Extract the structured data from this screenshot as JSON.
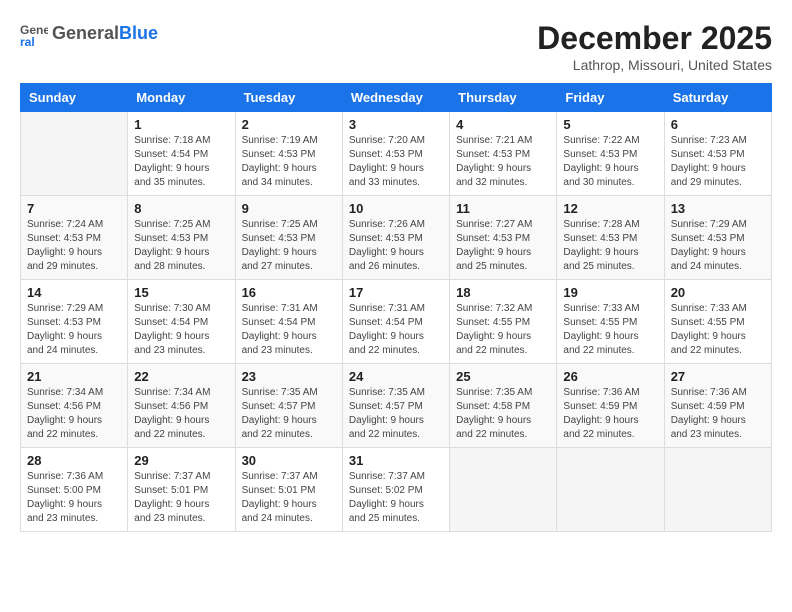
{
  "header": {
    "logo_general": "General",
    "logo_blue": "Blue",
    "title": "December 2025",
    "subtitle": "Lathrop, Missouri, United States"
  },
  "weekdays": [
    "Sunday",
    "Monday",
    "Tuesday",
    "Wednesday",
    "Thursday",
    "Friday",
    "Saturday"
  ],
  "weeks": [
    [
      {
        "day": "",
        "sunrise": "",
        "sunset": "",
        "daylight": ""
      },
      {
        "day": "1",
        "sunrise": "Sunrise: 7:18 AM",
        "sunset": "Sunset: 4:54 PM",
        "daylight": "Daylight: 9 hours and 35 minutes."
      },
      {
        "day": "2",
        "sunrise": "Sunrise: 7:19 AM",
        "sunset": "Sunset: 4:53 PM",
        "daylight": "Daylight: 9 hours and 34 minutes."
      },
      {
        "day": "3",
        "sunrise": "Sunrise: 7:20 AM",
        "sunset": "Sunset: 4:53 PM",
        "daylight": "Daylight: 9 hours and 33 minutes."
      },
      {
        "day": "4",
        "sunrise": "Sunrise: 7:21 AM",
        "sunset": "Sunset: 4:53 PM",
        "daylight": "Daylight: 9 hours and 32 minutes."
      },
      {
        "day": "5",
        "sunrise": "Sunrise: 7:22 AM",
        "sunset": "Sunset: 4:53 PM",
        "daylight": "Daylight: 9 hours and 30 minutes."
      },
      {
        "day": "6",
        "sunrise": "Sunrise: 7:23 AM",
        "sunset": "Sunset: 4:53 PM",
        "daylight": "Daylight: 9 hours and 29 minutes."
      }
    ],
    [
      {
        "day": "7",
        "sunrise": "Sunrise: 7:24 AM",
        "sunset": "Sunset: 4:53 PM",
        "daylight": "Daylight: 9 hours and 29 minutes."
      },
      {
        "day": "8",
        "sunrise": "Sunrise: 7:25 AM",
        "sunset": "Sunset: 4:53 PM",
        "daylight": "Daylight: 9 hours and 28 minutes."
      },
      {
        "day": "9",
        "sunrise": "Sunrise: 7:25 AM",
        "sunset": "Sunset: 4:53 PM",
        "daylight": "Daylight: 9 hours and 27 minutes."
      },
      {
        "day": "10",
        "sunrise": "Sunrise: 7:26 AM",
        "sunset": "Sunset: 4:53 PM",
        "daylight": "Daylight: 9 hours and 26 minutes."
      },
      {
        "day": "11",
        "sunrise": "Sunrise: 7:27 AM",
        "sunset": "Sunset: 4:53 PM",
        "daylight": "Daylight: 9 hours and 25 minutes."
      },
      {
        "day": "12",
        "sunrise": "Sunrise: 7:28 AM",
        "sunset": "Sunset: 4:53 PM",
        "daylight": "Daylight: 9 hours and 25 minutes."
      },
      {
        "day": "13",
        "sunrise": "Sunrise: 7:29 AM",
        "sunset": "Sunset: 4:53 PM",
        "daylight": "Daylight: 9 hours and 24 minutes."
      }
    ],
    [
      {
        "day": "14",
        "sunrise": "Sunrise: 7:29 AM",
        "sunset": "Sunset: 4:53 PM",
        "daylight": "Daylight: 9 hours and 24 minutes."
      },
      {
        "day": "15",
        "sunrise": "Sunrise: 7:30 AM",
        "sunset": "Sunset: 4:54 PM",
        "daylight": "Daylight: 9 hours and 23 minutes."
      },
      {
        "day": "16",
        "sunrise": "Sunrise: 7:31 AM",
        "sunset": "Sunset: 4:54 PM",
        "daylight": "Daylight: 9 hours and 23 minutes."
      },
      {
        "day": "17",
        "sunrise": "Sunrise: 7:31 AM",
        "sunset": "Sunset: 4:54 PM",
        "daylight": "Daylight: 9 hours and 22 minutes."
      },
      {
        "day": "18",
        "sunrise": "Sunrise: 7:32 AM",
        "sunset": "Sunset: 4:55 PM",
        "daylight": "Daylight: 9 hours and 22 minutes."
      },
      {
        "day": "19",
        "sunrise": "Sunrise: 7:33 AM",
        "sunset": "Sunset: 4:55 PM",
        "daylight": "Daylight: 9 hours and 22 minutes."
      },
      {
        "day": "20",
        "sunrise": "Sunrise: 7:33 AM",
        "sunset": "Sunset: 4:55 PM",
        "daylight": "Daylight: 9 hours and 22 minutes."
      }
    ],
    [
      {
        "day": "21",
        "sunrise": "Sunrise: 7:34 AM",
        "sunset": "Sunset: 4:56 PM",
        "daylight": "Daylight: 9 hours and 22 minutes."
      },
      {
        "day": "22",
        "sunrise": "Sunrise: 7:34 AM",
        "sunset": "Sunset: 4:56 PM",
        "daylight": "Daylight: 9 hours and 22 minutes."
      },
      {
        "day": "23",
        "sunrise": "Sunrise: 7:35 AM",
        "sunset": "Sunset: 4:57 PM",
        "daylight": "Daylight: 9 hours and 22 minutes."
      },
      {
        "day": "24",
        "sunrise": "Sunrise: 7:35 AM",
        "sunset": "Sunset: 4:57 PM",
        "daylight": "Daylight: 9 hours and 22 minutes."
      },
      {
        "day": "25",
        "sunrise": "Sunrise: 7:35 AM",
        "sunset": "Sunset: 4:58 PM",
        "daylight": "Daylight: 9 hours and 22 minutes."
      },
      {
        "day": "26",
        "sunrise": "Sunrise: 7:36 AM",
        "sunset": "Sunset: 4:59 PM",
        "daylight": "Daylight: 9 hours and 22 minutes."
      },
      {
        "day": "27",
        "sunrise": "Sunrise: 7:36 AM",
        "sunset": "Sunset: 4:59 PM",
        "daylight": "Daylight: 9 hours and 23 minutes."
      }
    ],
    [
      {
        "day": "28",
        "sunrise": "Sunrise: 7:36 AM",
        "sunset": "Sunset: 5:00 PM",
        "daylight": "Daylight: 9 hours and 23 minutes."
      },
      {
        "day": "29",
        "sunrise": "Sunrise: 7:37 AM",
        "sunset": "Sunset: 5:01 PM",
        "daylight": "Daylight: 9 hours and 23 minutes."
      },
      {
        "day": "30",
        "sunrise": "Sunrise: 7:37 AM",
        "sunset": "Sunset: 5:01 PM",
        "daylight": "Daylight: 9 hours and 24 minutes."
      },
      {
        "day": "31",
        "sunrise": "Sunrise: 7:37 AM",
        "sunset": "Sunset: 5:02 PM",
        "daylight": "Daylight: 9 hours and 25 minutes."
      },
      {
        "day": "",
        "sunrise": "",
        "sunset": "",
        "daylight": ""
      },
      {
        "day": "",
        "sunrise": "",
        "sunset": "",
        "daylight": ""
      },
      {
        "day": "",
        "sunrise": "",
        "sunset": "",
        "daylight": ""
      }
    ]
  ]
}
